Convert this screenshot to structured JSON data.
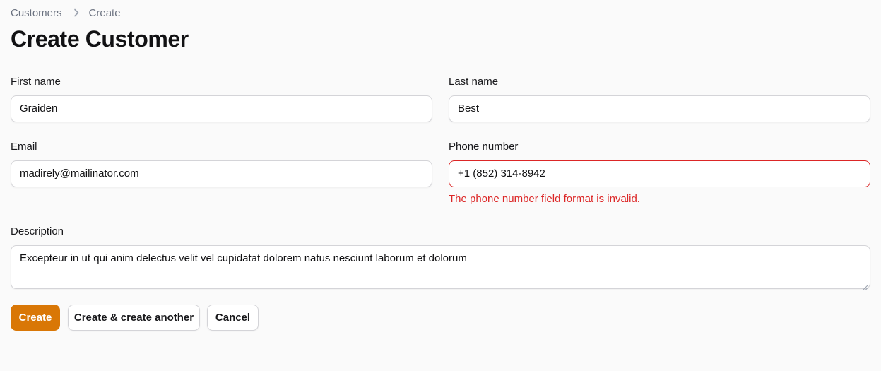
{
  "breadcrumb": {
    "items": [
      "Customers",
      "Create"
    ]
  },
  "page": {
    "title": "Create Customer"
  },
  "form": {
    "first_name": {
      "label": "First name",
      "value": "Graiden"
    },
    "last_name": {
      "label": "Last name",
      "value": "Best"
    },
    "email": {
      "label": "Email",
      "value": "madirely@mailinator.com"
    },
    "phone": {
      "label": "Phone number",
      "value": "+1 (852) 314-8942",
      "error": "The phone number field format is invalid."
    },
    "description": {
      "label": "Description",
      "value": "Excepteur in ut qui anim delectus velit vel cupidatat dolorem natus nesciunt laborum et dolorum"
    }
  },
  "actions": {
    "create": "Create",
    "create_another": "Create & create another",
    "cancel": "Cancel"
  },
  "colors": {
    "accent": "#d97706",
    "error": "#dc2626",
    "background": "#fafafa"
  },
  "icons": {
    "breadcrumb_separator": "chevron-right-icon",
    "textarea_resize": "resize-handle-icon"
  }
}
